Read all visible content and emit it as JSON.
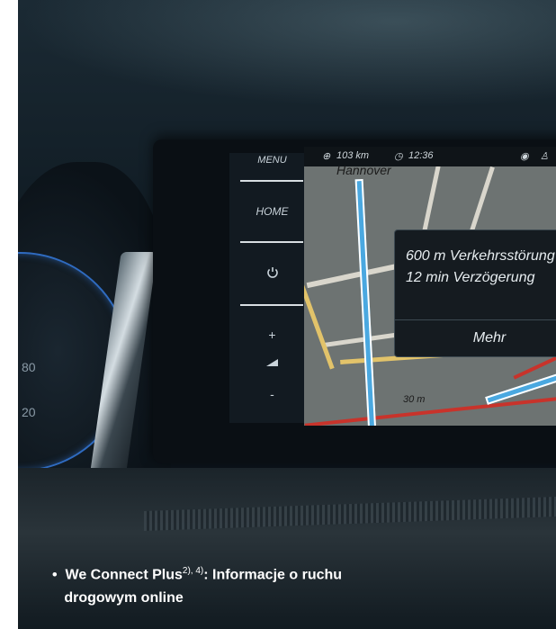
{
  "infotainment": {
    "side_menu": {
      "menu_label": "MENU",
      "home_label": "HOME",
      "power_icon": "power-icon",
      "plus_label": "+",
      "volume_icon": "volume-icon",
      "minus_label": "-"
    },
    "status_bar": {
      "distance": "103 km",
      "time": "12:36",
      "icons": [
        "globe-icon",
        "clock-icon",
        "compass-icon",
        "user-icon"
      ]
    },
    "map": {
      "city": "Hannover",
      "scale": "30 m"
    },
    "traffic_popup": {
      "line1": "600 m Verkehrsstörung",
      "line2": "12 min Verzögerung",
      "button": "Mehr"
    }
  },
  "caption": {
    "bullet": "•",
    "title": "We Connect Plus",
    "superscript": "2), 4)",
    "rest_line1": ": Informacje o ruchu",
    "rest_line2": "drogowym online"
  },
  "colors": {
    "route": "#4aa8e0",
    "traffic": "#c8332b",
    "gauge_ring": "#2f6bc0"
  }
}
